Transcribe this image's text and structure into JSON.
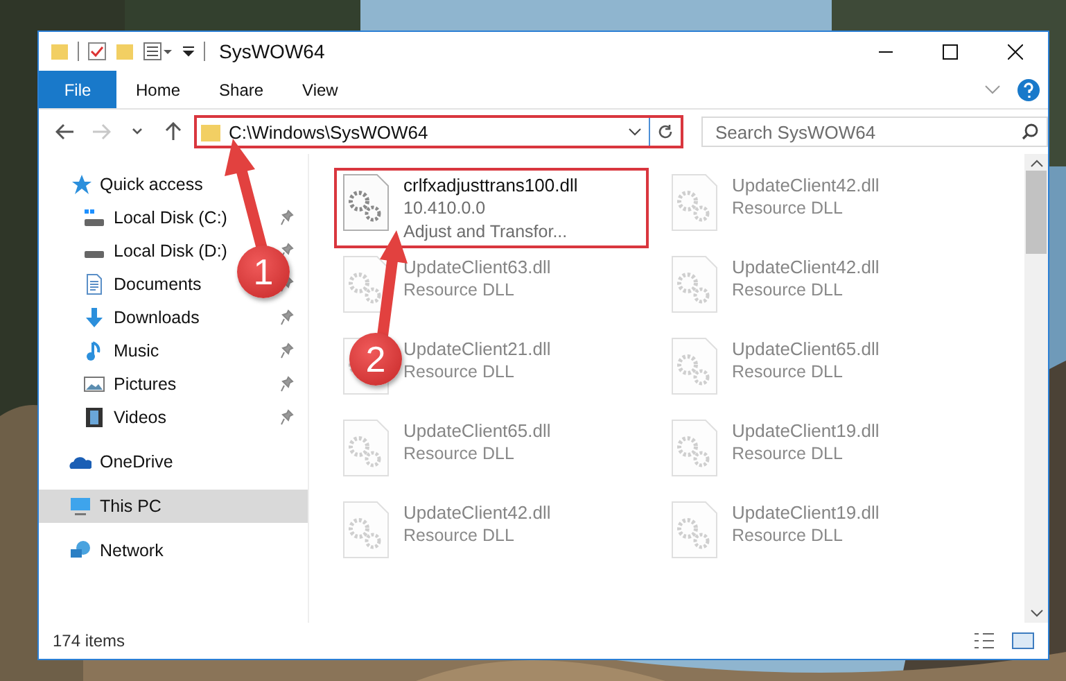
{
  "window": {
    "title": "SysWOW64"
  },
  "ribbon_tabs": [
    {
      "label": "File",
      "kind": "file"
    },
    {
      "label": "Home",
      "kind": "tab"
    },
    {
      "label": "Share",
      "kind": "tab"
    },
    {
      "label": "View",
      "kind": "tab"
    }
  ],
  "nav_buttons": [
    {
      "kind": "back",
      "disabled": false
    },
    {
      "kind": "forward",
      "disabled": true
    },
    {
      "kind": "recent",
      "disabled": false
    },
    {
      "kind": "up",
      "disabled": false
    }
  ],
  "address": {
    "path": "C:\\Windows\\SysWOW64",
    "highlighted": true
  },
  "search": {
    "placeholder": "Search SysWOW64"
  },
  "sidebar": {
    "items": [
      {
        "label": "Quick access",
        "kind": "star",
        "selected": false,
        "children": [
          {
            "label": "Local Disk (C:)",
            "kind": "windows-drive",
            "pinned": true,
            "selected": false
          },
          {
            "label": "Local Disk (D:)",
            "kind": "drive",
            "pinned": true,
            "selected": false
          },
          {
            "label": "Documents",
            "kind": "documents",
            "pinned": true,
            "selected": false
          },
          {
            "label": "Downloads",
            "kind": "downloads",
            "pinned": true,
            "selected": false
          },
          {
            "label": "Music",
            "kind": "music",
            "pinned": true,
            "selected": false
          },
          {
            "label": "Pictures",
            "kind": "pictures",
            "pinned": true,
            "selected": false
          },
          {
            "label": "Videos",
            "kind": "videos",
            "pinned": true,
            "selected": false
          }
        ]
      },
      {
        "label": "OneDrive",
        "kind": "cloud",
        "selected": false
      },
      {
        "label": "This PC",
        "kind": "computer",
        "selected": true
      },
      {
        "label": "Network",
        "kind": "network",
        "selected": false
      }
    ]
  },
  "files": [
    {
      "name": "crlfxadjusttrans100.dll",
      "details": [
        "10.410.0.0",
        "Adjust and Transfor..."
      ],
      "highlighted": true,
      "blurred": false
    },
    {
      "name": "UpdateClient42.dll",
      "details": [
        "Resource DLL"
      ],
      "highlighted": false,
      "blurred": true
    },
    {
      "name": "UpdateClient63.dll",
      "details": [
        "Resource DLL"
      ],
      "highlighted": false,
      "blurred": true
    },
    {
      "name": "UpdateClient42.dll",
      "details": [
        "Resource DLL"
      ],
      "highlighted": false,
      "blurred": true
    },
    {
      "name": "UpdateClient21.dll",
      "details": [
        "Resource DLL"
      ],
      "highlighted": false,
      "blurred": true
    },
    {
      "name": "UpdateClient65.dll",
      "details": [
        "Resource DLL"
      ],
      "highlighted": false,
      "blurred": true
    },
    {
      "name": "UpdateClient65.dll",
      "details": [
        "Resource DLL"
      ],
      "highlighted": false,
      "blurred": true
    },
    {
      "name": "UpdateClient19.dll",
      "details": [
        "Resource DLL"
      ],
      "highlighted": false,
      "blurred": true
    },
    {
      "name": "UpdateClient42.dll",
      "details": [
        "Resource DLL"
      ],
      "highlighted": false,
      "blurred": true
    },
    {
      "name": "UpdateClient19.dll",
      "details": [
        "Resource DLL"
      ],
      "highlighted": false,
      "blurred": true
    }
  ],
  "status_bar": {
    "item_count": "174 items"
  },
  "annotations": [
    {
      "number": "1"
    },
    {
      "number": "2"
    }
  ]
}
